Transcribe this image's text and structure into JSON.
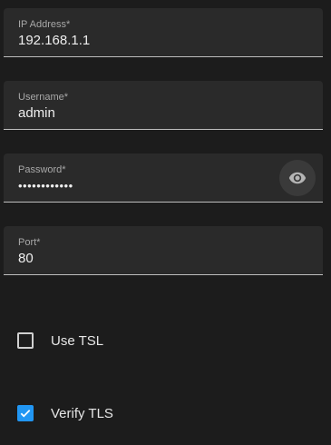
{
  "form": {
    "ip": {
      "label": "IP Address*",
      "value": "192.168.1.1"
    },
    "username": {
      "label": "Username*",
      "value": "admin"
    },
    "password": {
      "label": "Password*",
      "value": "••••••••••••",
      "toggle_icon": "eye-icon"
    },
    "port": {
      "label": "Port*",
      "value": "80"
    }
  },
  "options": {
    "use_tsl": {
      "label": "Use TSL",
      "checked": false
    },
    "verify_tls": {
      "label": "Verify TLS",
      "checked": true
    }
  },
  "colors": {
    "background": "#1c1c1c",
    "field_bg": "#2a2a2a",
    "accent": "#2196f3"
  }
}
